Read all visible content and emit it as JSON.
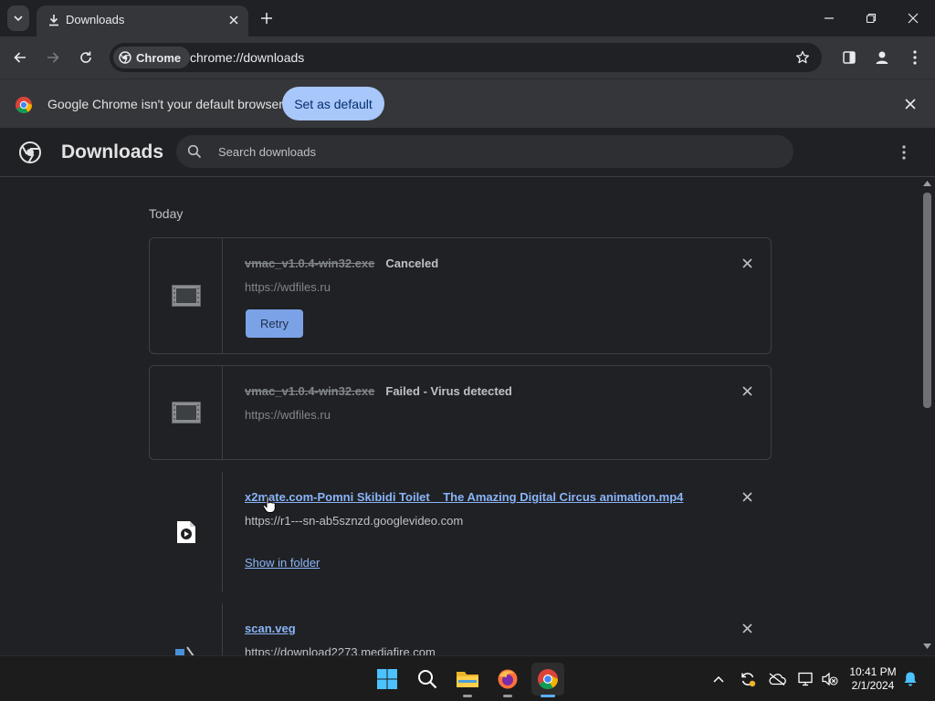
{
  "browser": {
    "tab": {
      "title": "Downloads"
    },
    "omnibox": {
      "chip_label": "Chrome",
      "url": "chrome://downloads"
    }
  },
  "infobar": {
    "message": "Google Chrome isn't your default browser",
    "button_label": "Set as default"
  },
  "downloads": {
    "title": "Downloads",
    "search_placeholder": "Search downloads",
    "section_label": "Today",
    "items": [
      {
        "filename": "vmac_v1.0.4-win32.exe",
        "status": "Canceled",
        "url": "https://wdfiles.ru",
        "action_label": "Retry"
      },
      {
        "filename": "vmac_v1.0.4-win32.exe",
        "status": "Failed - Virus detected",
        "url": "https://wdfiles.ru"
      },
      {
        "filename": "x2mate.com-Pomni Skibidi Toilet _ The Amazing Digital Circus animation.mp4",
        "url": "https://r1---sn-ab5sznzd.googlevideo.com",
        "action_label": "Show in folder"
      },
      {
        "filename": "scan.veg",
        "url": "https://download2273.mediafire.com"
      }
    ]
  },
  "taskbar": {
    "clock": {
      "time": "10:41 PM",
      "date": "2/1/2024"
    }
  },
  "colors": {
    "background": "#202124",
    "toolbar": "#35363a",
    "accent": "#a8c7fa",
    "link": "#8ab4f8",
    "retry_button": "#7ba2e6",
    "taskbar": "#1c1c1c"
  }
}
